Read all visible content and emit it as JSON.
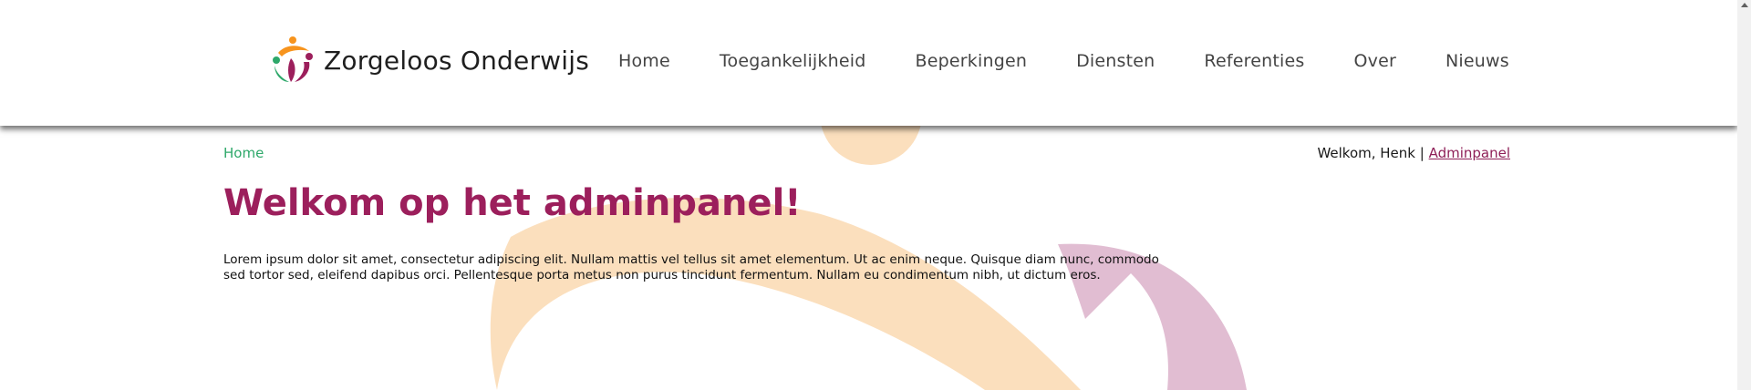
{
  "brand": {
    "name": "Zorgeloos Onderwijs",
    "colors": {
      "orange": "#f7941d",
      "magenta": "#9c1f5c",
      "green": "#2ea86a"
    }
  },
  "nav": {
    "items": [
      {
        "label": "Home"
      },
      {
        "label": "Toegankelijkheid"
      },
      {
        "label": "Beperkingen"
      },
      {
        "label": "Diensten"
      },
      {
        "label": "Referenties"
      },
      {
        "label": "Over"
      },
      {
        "label": "Nieuws"
      }
    ]
  },
  "breadcrumb": {
    "home": "Home"
  },
  "user": {
    "welcome": "Welkom, Henk |",
    "admin_link": "Adminpanel"
  },
  "main": {
    "title": "Welkom op het adminpanel!",
    "intro": "Lorem ipsum dolor sit amet, consectetur adipiscing elit. Nullam mattis vel tellus sit amet elementum. Ut ac enim neque. Quisque diam nunc, commodo sed tortor sed, eleifend dapibus orci. Pellentesque porta metus non purus tincidunt fermentum. Nullam eu condimentum nibh, ut dictum eros."
  },
  "icons": {
    "logo": "people-circle-logo-icon",
    "scroll": "scroll-up-arrow-icon"
  }
}
